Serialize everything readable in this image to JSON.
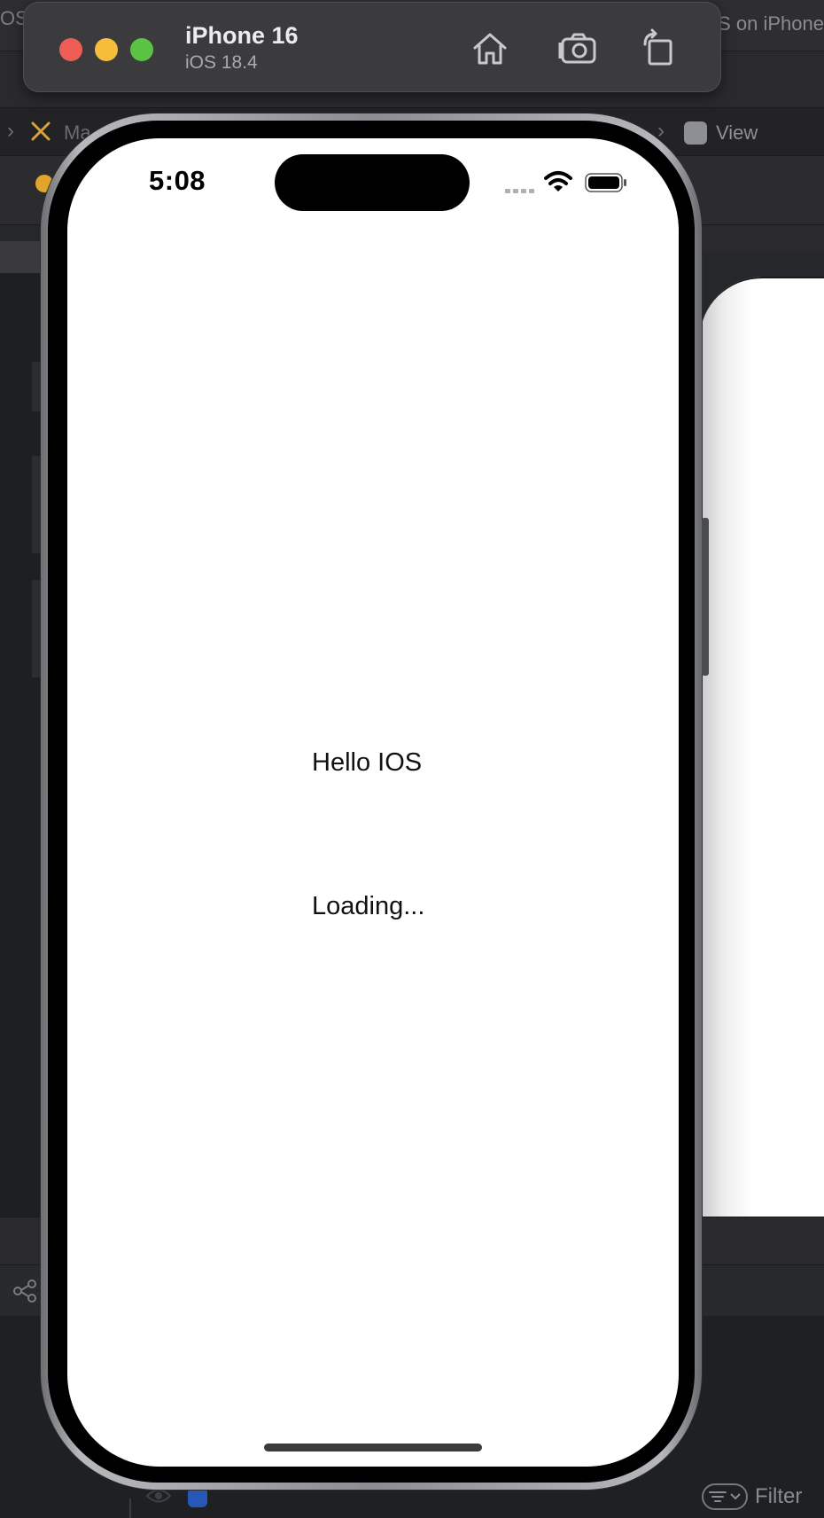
{
  "simulator": {
    "device_name": "iPhone 16",
    "os_version": "iOS 18.4",
    "toolbar": {
      "home_icon": "house-icon",
      "screenshot_icon": "camera-icon",
      "rotate_icon": "rotate-icon"
    }
  },
  "background_ide": {
    "top_left_fragment": "OS",
    "top_right_fragment": "S on iPhone",
    "breadcrumb_fragment": "Ma",
    "breadcrumb_view": "View",
    "filter_label": "Filter",
    "colors": {
      "toggle_accent": "#2758b8",
      "warning": "#e0a52a"
    }
  },
  "phone": {
    "status_bar": {
      "time": "5:08"
    },
    "content": {
      "greeting": "Hello IOS",
      "status": "Loading..."
    }
  }
}
